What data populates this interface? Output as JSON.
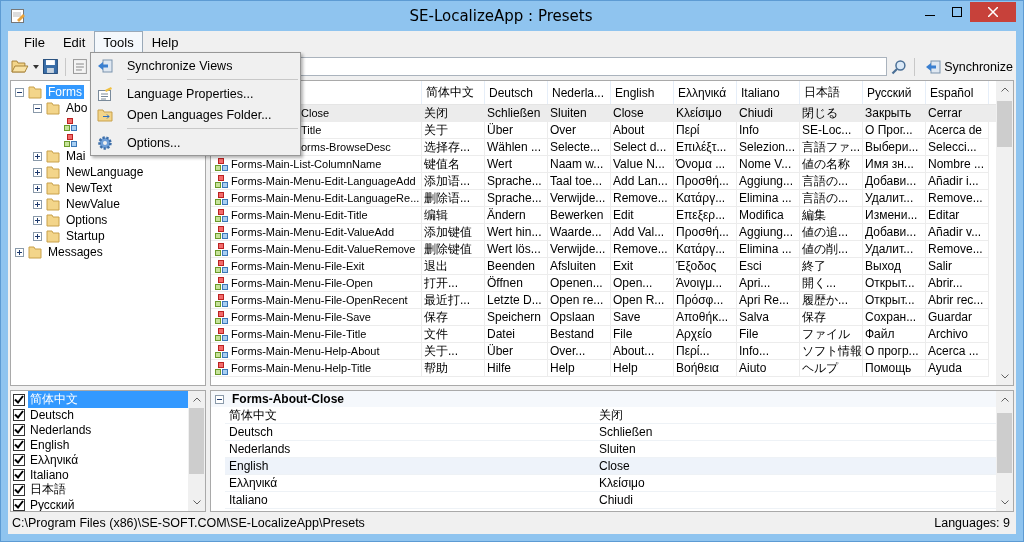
{
  "window": {
    "title": "SE-LocalizeApp : Presets"
  },
  "menu_bar": [
    {
      "label": "File",
      "selected": false
    },
    {
      "label": "Edit",
      "selected": false
    },
    {
      "label": "Tools",
      "selected": true
    },
    {
      "label": "Help",
      "selected": false
    }
  ],
  "tools_menu": [
    {
      "kind": "item",
      "label": "Synchronize Views"
    },
    {
      "kind": "separator"
    },
    {
      "kind": "item",
      "label": "Language Properties..."
    },
    {
      "kind": "item",
      "label": "Open Languages Folder..."
    },
    {
      "kind": "separator"
    },
    {
      "kind": "item",
      "label": "Options..."
    }
  ],
  "toolbar": {
    "sync_button": "Synchronize"
  },
  "tree": [
    {
      "label": "Forms",
      "expanded": true,
      "selected": true,
      "children": [
        {
          "label": "Abo",
          "expanded": true,
          "selected": false,
          "children": [
            {
              "kind": "value"
            },
            {
              "kind": "value"
            }
          ]
        },
        {
          "label": "Mai",
          "expanded": false,
          "selected": false
        },
        {
          "label": "NewLanguage",
          "expanded": false,
          "selected": false
        },
        {
          "label": "NewText",
          "expanded": false,
          "selected": false
        },
        {
          "label": "NewValue",
          "expanded": false,
          "selected": false
        },
        {
          "label": "Options",
          "expanded": false,
          "selected": false
        },
        {
          "label": "Startup",
          "expanded": false,
          "selected": false
        }
      ]
    },
    {
      "label": "Messages",
      "expanded": false,
      "selected": false
    }
  ],
  "table": {
    "columns": [
      "简体中文",
      "Deutsch",
      "Nederla...",
      "English",
      "Ελληνικά",
      "Italiano",
      "日本語",
      "Русский",
      "Español"
    ],
    "rows": [
      {
        "kind": "partial",
        "selected": true,
        "name": "Close",
        "values": [
          "关闭",
          "Schließen",
          "Sluiten",
          "Close",
          "Κλείσιμο",
          "Chiudi",
          "閉じる",
          "Закрыть",
          "Cerrar"
        ]
      },
      {
        "kind": "partial",
        "selected": false,
        "name": "Title",
        "values": [
          "关于",
          "Über",
          "Over",
          "About",
          "Περί",
          "Info",
          "SE-Loc...",
          "О Прог...",
          "Acerca de"
        ]
      },
      {
        "kind": "partial",
        "selected": false,
        "name": "orms-BrowseDesc",
        "values": [
          "选择存...",
          "Wählen ...",
          "Selecte...",
          "Select d...",
          "Επιλέξτ...",
          "Selezion...",
          "言語ファ...",
          "Выбери...",
          "Selecci..."
        ]
      },
      {
        "kind": "value",
        "selected": false,
        "name": "Forms-Main-List-ColumnName",
        "values": [
          "键值名",
          "Wert",
          "Naam w...",
          "Value N...",
          "Όνομα ...",
          "Nome V...",
          "値の名称",
          "Имя зн...",
          "Nombre ..."
        ]
      },
      {
        "kind": "value",
        "selected": false,
        "name": "Forms-Main-Menu-Edit-LanguageAdd",
        "values": [
          "添加语...",
          "Sprache...",
          "Taal toe...",
          "Add Lan...",
          "Προσθή...",
          "Aggiung...",
          "言語の...",
          "Добави...",
          "Añadir i..."
        ]
      },
      {
        "kind": "value",
        "selected": false,
        "name": "Forms-Main-Menu-Edit-LanguageRe...",
        "values": [
          "删除语...",
          "Sprache...",
          "Verwijde...",
          "Remove...",
          "Κατάργ...",
          "Elimina ...",
          "言語の...",
          "Удалит...",
          "Remove..."
        ]
      },
      {
        "kind": "value",
        "selected": false,
        "name": "Forms-Main-Menu-Edit-Title",
        "values": [
          "编辑",
          "Ändern",
          "Bewerken",
          "Edit",
          "Επεξερ...",
          "Modifica",
          "編集",
          "Измени...",
          "Editar"
        ]
      },
      {
        "kind": "value",
        "selected": false,
        "name": "Forms-Main-Menu-Edit-ValueAdd",
        "values": [
          "添加键值",
          "Wert hin...",
          "Waarde...",
          "Add Val...",
          "Προσθή...",
          "Aggiung...",
          "値の追...",
          "Добави...",
          "Añadir v..."
        ]
      },
      {
        "kind": "value",
        "selected": false,
        "name": "Forms-Main-Menu-Edit-ValueRemove",
        "values": [
          "删除键值",
          "Wert lös...",
          "Verwijde...",
          "Remove...",
          "Κατάργ...",
          "Elimina ...",
          "値の削...",
          "Удалит...",
          "Remove..."
        ]
      },
      {
        "kind": "value",
        "selected": false,
        "name": "Forms-Main-Menu-File-Exit",
        "values": [
          "退出",
          "Beenden",
          "Afsluiten",
          "Exit",
          "Έξοδος",
          "Esci",
          "終了",
          "Выход",
          "Salir"
        ]
      },
      {
        "kind": "value",
        "selected": false,
        "name": "Forms-Main-Menu-File-Open",
        "values": [
          "打开...",
          "Öffnen",
          "Openen...",
          "Open...",
          "Άνοιγμ...",
          "Apri...",
          "開く...",
          "Открыт...",
          "Abrir..."
        ]
      },
      {
        "kind": "value",
        "selected": false,
        "name": "Forms-Main-Menu-File-OpenRecent",
        "values": [
          "最近打...",
          "Letzte D...",
          "Open re...",
          "Open R...",
          "Πρόσφ...",
          "Apri Re...",
          "履歴か...",
          "Открыт...",
          "Abrir rec..."
        ]
      },
      {
        "kind": "value",
        "selected": false,
        "name": "Forms-Main-Menu-File-Save",
        "values": [
          "保存",
          "Speichern",
          "Opslaan",
          "Save",
          "Αποθήκ...",
          "Salva",
          "保存",
          "Сохран...",
          "Guardar"
        ]
      },
      {
        "kind": "value",
        "selected": false,
        "name": "Forms-Main-Menu-File-Title",
        "values": [
          "文件",
          "Datei",
          "Bestand",
          "File",
          "Αρχείο",
          "File",
          "ファイル",
          "Файл",
          "Archivo"
        ]
      },
      {
        "kind": "value",
        "selected": false,
        "name": "Forms-Main-Menu-Help-About",
        "values": [
          "关于...",
          "Über",
          "Over...",
          "About...",
          "Περί...",
          "Info...",
          "ソフト情報",
          "О прогр...",
          "Acerca ..."
        ]
      },
      {
        "kind": "value",
        "selected": false,
        "name": "Forms-Main-Menu-Help-Title",
        "values": [
          "帮助",
          "Hilfe",
          "Help",
          "Help",
          "Βοήθεια",
          "Aiuto",
          "ヘルプ",
          "Помощь",
          "Ayuda"
        ]
      }
    ]
  },
  "languages": [
    {
      "label": "简体中文",
      "checked": true,
      "selected": true
    },
    {
      "label": "Deutsch",
      "checked": true,
      "selected": false
    },
    {
      "label": "Nederlands",
      "checked": true,
      "selected": false
    },
    {
      "label": "English",
      "checked": true,
      "selected": false
    },
    {
      "label": "Ελληνικά",
      "checked": true,
      "selected": false
    },
    {
      "label": "Italiano",
      "checked": true,
      "selected": false
    },
    {
      "label": "日本語",
      "checked": true,
      "selected": false
    },
    {
      "label": "Русский",
      "checked": true,
      "selected": false
    }
  ],
  "detail": {
    "title": "Forms-About-Close",
    "expanded": true,
    "rows": [
      {
        "language": "简体中文",
        "value": "关闭",
        "selected": false
      },
      {
        "language": "Deutsch",
        "value": "Schließen",
        "selected": false
      },
      {
        "language": "Nederlands",
        "value": "Sluiten",
        "selected": false
      },
      {
        "language": "English",
        "value": "Close",
        "selected": true
      },
      {
        "language": "Ελληνικά",
        "value": "Κλείσιμο",
        "selected": false
      },
      {
        "language": "Italiano",
        "value": "Chiudi",
        "selected": false
      }
    ]
  },
  "status_bar": {
    "path": "C:\\Program Files (x86)\\SE-SOFT.COM\\SE-LocalizeApp\\Presets",
    "count": "Languages: 9"
  }
}
